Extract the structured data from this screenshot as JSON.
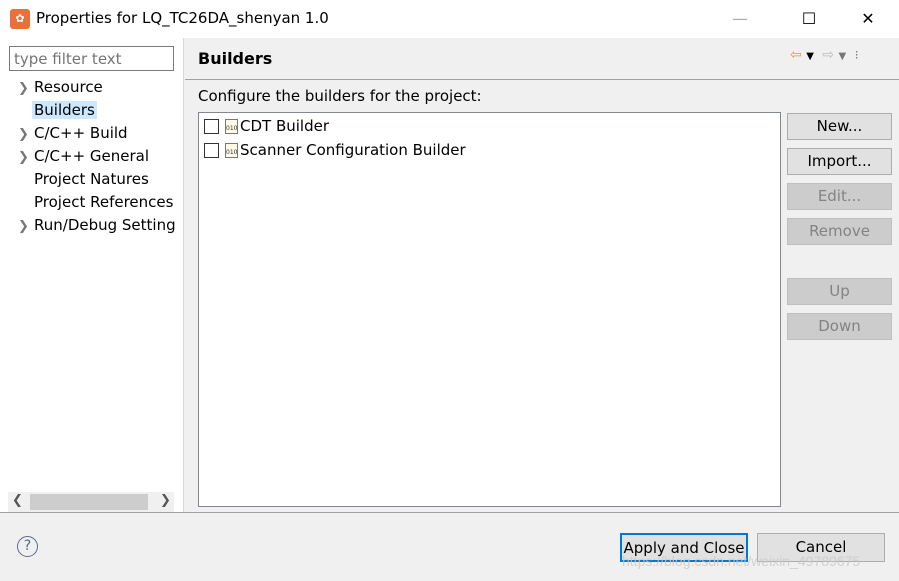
{
  "window": {
    "title": "Properties for LQ_TC26DA_shenyan 1.0",
    "minimize": "—",
    "maximize": "☐",
    "close": "✕"
  },
  "sidebar": {
    "filter_placeholder": "type filter text",
    "items": [
      {
        "label": "Resource",
        "expandable": true
      },
      {
        "label": "Builders",
        "expandable": false,
        "selected": true
      },
      {
        "label": "C/C++ Build",
        "expandable": true
      },
      {
        "label": "C/C++ General",
        "expandable": true
      },
      {
        "label": "Project Natures",
        "expandable": false
      },
      {
        "label": "Project References",
        "expandable": false
      },
      {
        "label": "Run/Debug Setting",
        "expandable": true
      }
    ]
  },
  "main": {
    "title": "Builders",
    "description": "Configure the builders for the project:",
    "builders": [
      {
        "label": "CDT Builder",
        "checked": false
      },
      {
        "label": "Scanner Configuration Builder",
        "checked": false
      }
    ],
    "buttons": {
      "new": "New...",
      "import": "Import...",
      "edit": "Edit...",
      "remove": "Remove",
      "up": "Up",
      "down": "Down"
    }
  },
  "footer": {
    "apply_close": "Apply and Close",
    "cancel": "Cancel",
    "help": "?"
  },
  "watermark": "https://blog.csdn.net/weixin_49789675",
  "colors": {
    "accent": "#0078d7",
    "selection": "#cce8ff",
    "back_arrow": "#e0a020"
  }
}
